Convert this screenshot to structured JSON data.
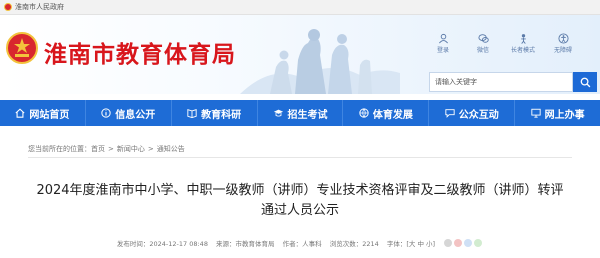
{
  "topbar": {
    "text": "淮南市人民政府"
  },
  "header": {
    "site_title": "淮南市教育体育局",
    "quick_links": [
      {
        "label": "登录",
        "icon": "user-icon"
      },
      {
        "label": "微信",
        "icon": "wechat-icon"
      },
      {
        "label": "长者模式",
        "icon": "elder-mode-icon"
      },
      {
        "label": "无障碍",
        "icon": "accessibility-icon"
      }
    ],
    "search_placeholder": "请输入关键字"
  },
  "nav": [
    {
      "label": "网站首页",
      "icon": "home-icon"
    },
    {
      "label": "信息公开",
      "icon": "info-icon"
    },
    {
      "label": "教育科研",
      "icon": "book-icon"
    },
    {
      "label": "招生考试",
      "icon": "graduation-cap-icon"
    },
    {
      "label": "体育发展",
      "icon": "sport-icon"
    },
    {
      "label": "公众互动",
      "icon": "chat-icon"
    },
    {
      "label": "网上办事",
      "icon": "computer-icon"
    }
  ],
  "breadcrumb": {
    "prefix": "您当前所在的位置：",
    "items": [
      "首页",
      "新闻中心",
      "通知公告"
    ],
    "separator": ">"
  },
  "article": {
    "title": "2024年度淮南市中小学、中职一级教师（讲师）专业技术资格评审及二级教师（讲师）转评通过人员公示",
    "publish_time": "发布时间：2024-12-17 08:48",
    "source": "来源：市教育体育局",
    "author": "作者：人事科",
    "views": "浏览次数：2214",
    "font_size_label": "字体：",
    "font_sizes": [
      "大",
      "中",
      "小"
    ],
    "color_dots": [
      "#d6d6d6",
      "#f3c3c3",
      "#cfe0f5",
      "#d2ecd0"
    ]
  },
  "colors": {
    "brand_red": "#d8161c",
    "nav_blue": "#1e6cd6"
  }
}
